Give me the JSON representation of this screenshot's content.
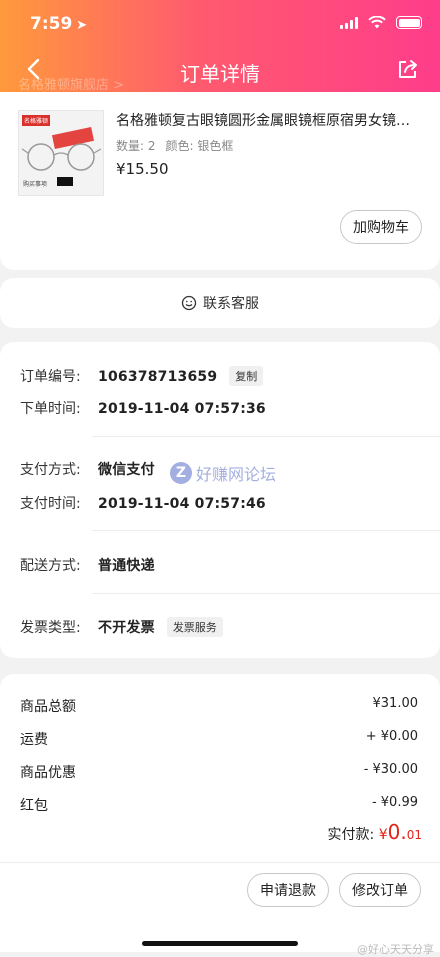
{
  "status": {
    "time": "7:59",
    "location_icon": "location-arrow-icon"
  },
  "nav": {
    "title": "订单详情",
    "shop_ghost": "名格雅顿旗舰店 >"
  },
  "product": {
    "title": "名格雅顿复古眼镜圆形金属眼镜框原宿男女镜架平...",
    "quantity": "数量: 2",
    "color": "颜色: 银色框",
    "price": "¥15.50",
    "thumb_brand": "名格雅顿",
    "thumb_foot": "购买事项",
    "cart_button": "加购物车"
  },
  "service": {
    "label": "联系客服"
  },
  "order_info": {
    "order_no_label": "订单编号:",
    "order_no": "106378713659",
    "copy_label": "复制",
    "order_time_label": "下单时间:",
    "order_time": "2019-11-04 07:57:36",
    "pay_method_label": "支付方式:",
    "pay_method": "微信支付",
    "pay_time_label": "支付时间:",
    "pay_time": "2019-11-04 07:57:46",
    "delivery_label": "配送方式:",
    "delivery": "普通快递",
    "invoice_label": "发票类型:",
    "invoice": "不开发票",
    "invoice_service": "发票服务"
  },
  "watermark": {
    "logo": "Z",
    "text": "好赚网论坛"
  },
  "amounts": {
    "goods_total_label": "商品总额",
    "goods_total": "¥31.00",
    "shipping_label": "运费",
    "shipping": "+ ¥0.00",
    "discount_label": "商品优惠",
    "discount": "- ¥30.00",
    "redpacket_label": "红包",
    "redpacket": "- ¥0.99",
    "paid_label": "实付款:",
    "paid_currency": "¥",
    "paid_int": "0.",
    "paid_dec": "01"
  },
  "actions": {
    "refund": "申请退款",
    "modify": "修改订单"
  },
  "footer": {
    "weibo": "@好心天天分享"
  },
  "colors": {
    "accent": "#ff3d8b",
    "price_red": "#e2231a"
  }
}
